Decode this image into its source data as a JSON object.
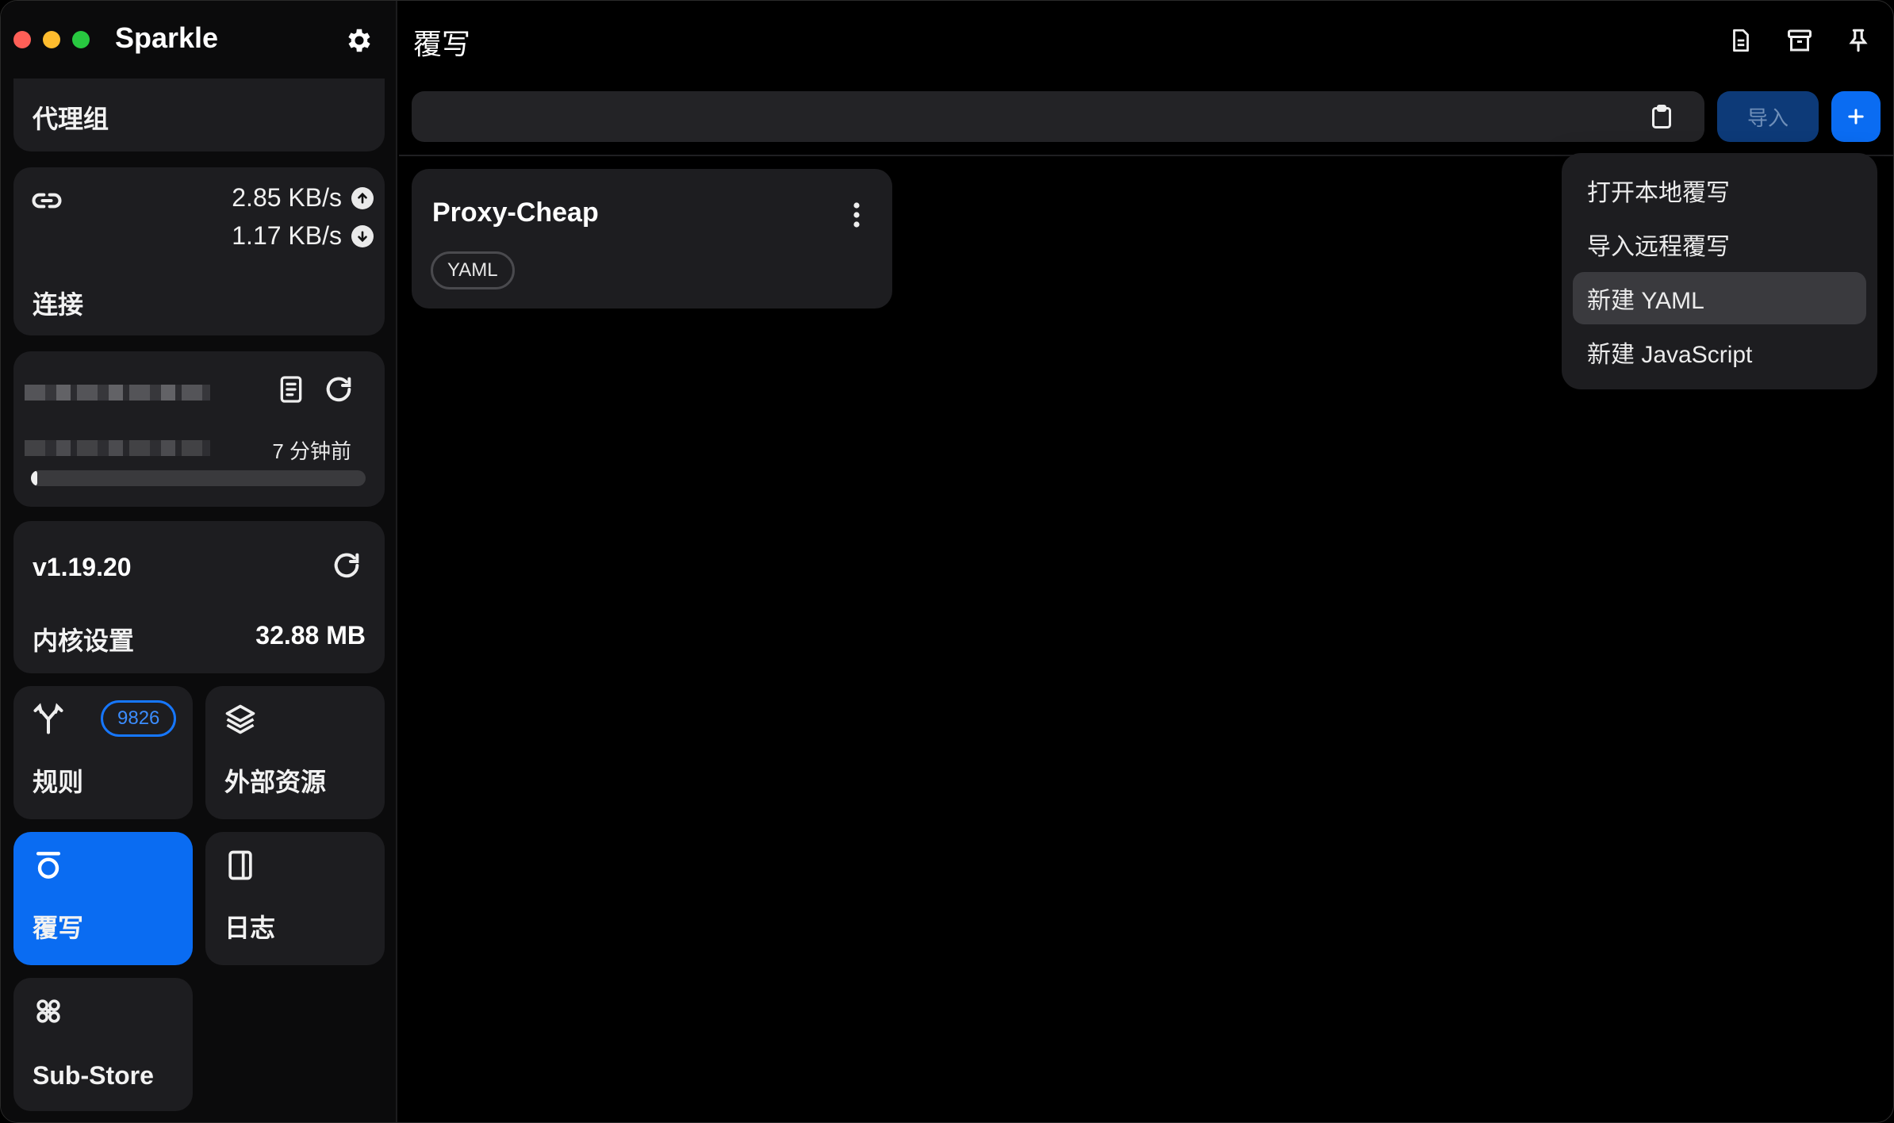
{
  "app": {
    "title": "Sparkle"
  },
  "sidebar": {
    "proxy_group": {
      "label": "代理组"
    },
    "connections": {
      "label": "连接",
      "upload_speed": "2.85 KB/s",
      "download_speed": "1.17 KB/s"
    },
    "profile": {
      "updated": "7 分钟前",
      "usage_fraction": 0.02
    },
    "core": {
      "version": "v1.19.20",
      "label": "内核设置",
      "memory": "32.88 MB"
    },
    "tiles": {
      "rules": {
        "label": "规则",
        "count": "9826"
      },
      "resources": {
        "label": "外部资源"
      },
      "override": {
        "label": "覆写"
      },
      "logs": {
        "label": "日志"
      },
      "substore": {
        "label": "Sub-Store"
      }
    }
  },
  "main": {
    "title": "覆写",
    "url_input": {
      "value": "",
      "placeholder": ""
    },
    "import_label": "导入",
    "add_label": "+",
    "cards": [
      {
        "name": "Proxy-Cheap",
        "tag": "YAML"
      }
    ],
    "menu": {
      "items": [
        "打开本地覆写",
        "导入远程覆写",
        "新建 YAML",
        "新建 JavaScript"
      ],
      "active_index": 2
    }
  },
  "colors": {
    "accent": "#0a6cf2",
    "background": "#000000",
    "card": "#1d1d20"
  }
}
